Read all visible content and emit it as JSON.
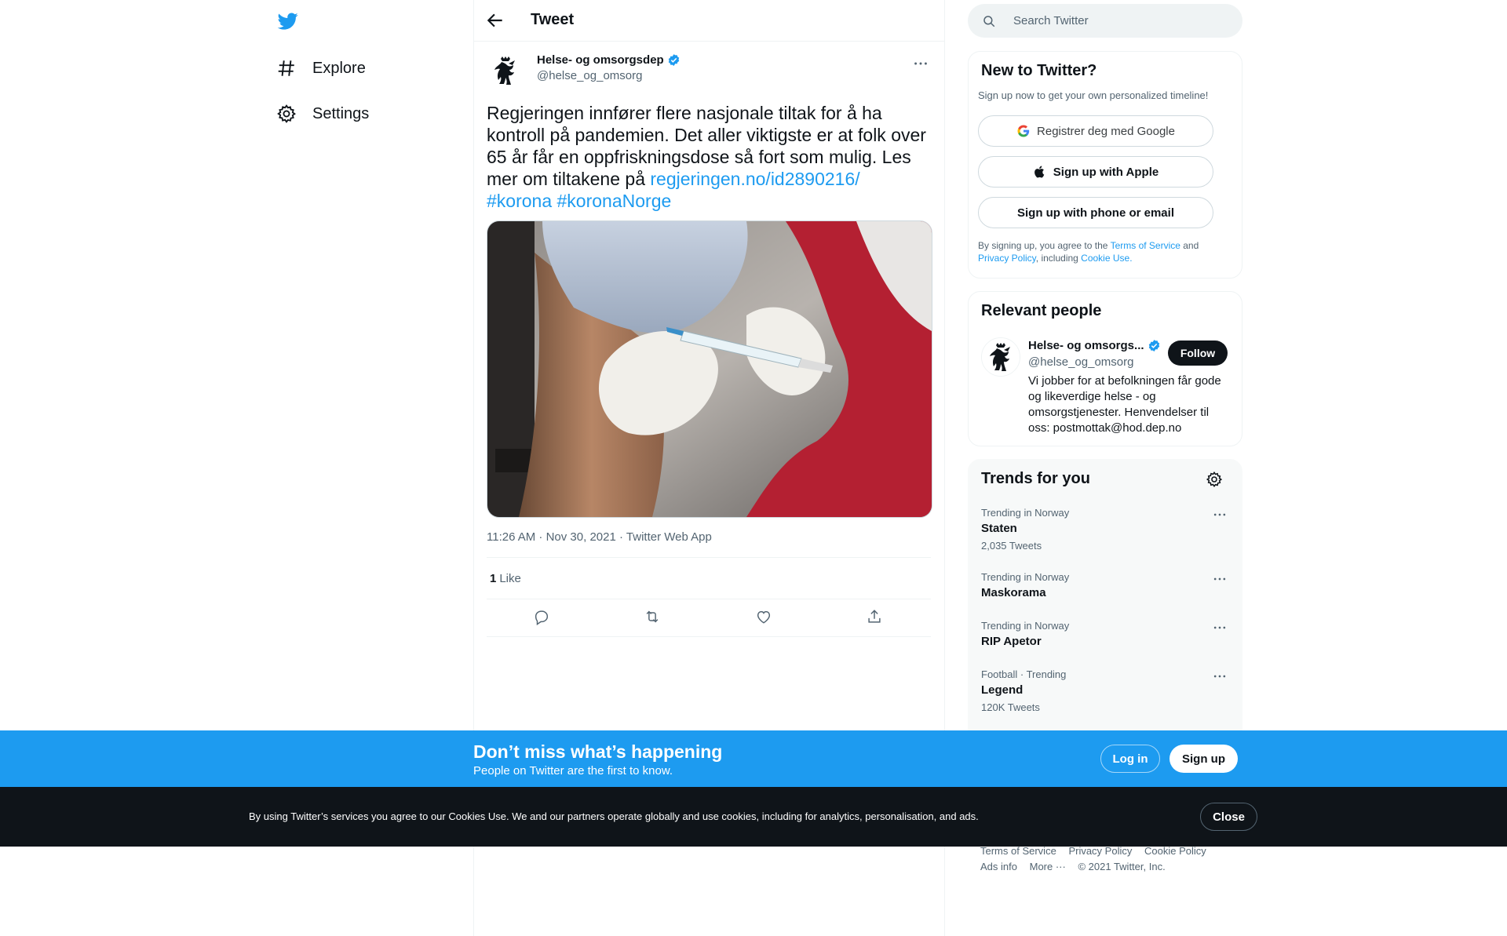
{
  "nav": {
    "items": [
      {
        "label": "Explore",
        "icon": "hashtag-icon"
      },
      {
        "label": "Settings",
        "icon": "gear-icon"
      }
    ]
  },
  "header": {
    "title": "Tweet"
  },
  "tweet": {
    "author_name": "Helse- og omsorgsdep",
    "author_handle": "@helse_og_omsorg",
    "text_before": "Regjeringen innfører flere nasjonale tiltak for å ha kontroll på pandemien. Det aller viktigste er at folk over 65 år får en oppfriskningsdose så fort som mulig. Les mer om tiltakene på ",
    "link": "regjeringen.no/id2890216/",
    "hashtags": [
      "#korona",
      "#koronaNorge"
    ],
    "timestamp": "11:26 AM · Nov 30, 2021",
    "source": "Twitter Web App",
    "likes_count": "1",
    "likes_label": "Like"
  },
  "search": {
    "placeholder": "Search Twitter"
  },
  "new_to_twitter": {
    "title": "New to Twitter?",
    "subtitle": "Sign up now to get your own personalized timeline!",
    "google_label": "Registrer deg med Google",
    "apple_label": "Sign up with Apple",
    "phone_label": "Sign up with phone or email",
    "terms_prefix": "By signing up, you agree to the ",
    "terms_link": "Terms of Service",
    "terms_and": " and ",
    "privacy_link": "Privacy Policy",
    "terms_including": ", including ",
    "cookie_link": "Cookie Use."
  },
  "relevant_people": {
    "title": "Relevant people",
    "name": "Helse- og omsorgs...",
    "handle": "@helse_og_omsorg",
    "follow_label": "Follow",
    "bio": "Vi jobber for at befolkningen får gode og likeverdige helse - og omsorgstjenester. Henvendelser til oss: postmottak@hod.dep.no"
  },
  "trends": {
    "title": "Trends for you",
    "items": [
      {
        "context": "Trending in Norway",
        "name": "Staten",
        "count": "2,035 Tweets"
      },
      {
        "context": "Trending in Norway",
        "name": "Maskorama",
        "count": ""
      },
      {
        "context": "Trending in Norway",
        "name": "RIP Apetor",
        "count": ""
      },
      {
        "context": "Football · Trending",
        "name": "Legend",
        "count": "120K Tweets"
      }
    ]
  },
  "footer": {
    "links": [
      "Terms of Service",
      "Privacy Policy",
      "Cookie Policy"
    ],
    "ads_info": "Ads info",
    "more": "More ···",
    "copyright": "© 2021 Twitter, Inc."
  },
  "bottom_bar": {
    "title": "Don’t miss what’s happening",
    "subtitle": "People on Twitter are the first to know.",
    "login_label": "Log in",
    "signup_label": "Sign up"
  },
  "cookie_bar": {
    "text": "By using Twitter’s services you agree to our Cookies Use. We and our partners operate globally and use cookies, including for analytics, personalisation, and ads.",
    "close_label": "Close"
  },
  "colors": {
    "accent": "#1d9bf0",
    "text": "#0f1419",
    "muted": "#536471",
    "dark_bar": "#0f1419"
  }
}
